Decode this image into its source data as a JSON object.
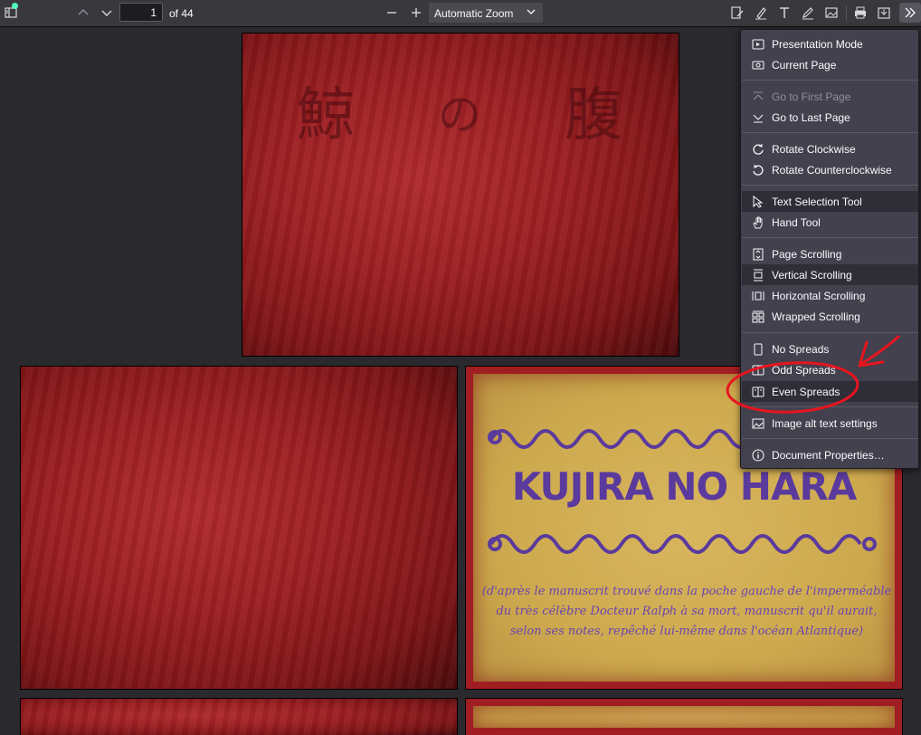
{
  "toolbar": {
    "page_number": "1",
    "page_count": "of 44",
    "zoom_value": "Automatic Zoom"
  },
  "document": {
    "cover_kanji": [
      "鯨",
      "の",
      "腹"
    ],
    "title": "KUJIRA NO HARA",
    "caption": "(d'après le manuscrit trouvé dans la poche gauche de l'imperméable du très célèbre Docteur Ralph à sa mort, manuscrit qu'il aurait, selon ses notes, repêché lui-même dans l'océan Atlantique)"
  },
  "menu": {
    "items": [
      {
        "label": "Presentation Mode",
        "icon": "presentation-icon"
      },
      {
        "label": "Current Page",
        "icon": "current-page-icon"
      },
      {
        "label": "Go to First Page",
        "icon": "first-page-icon",
        "disabled": true
      },
      {
        "label": "Go to Last Page",
        "icon": "last-page-icon"
      },
      {
        "label": "Rotate Clockwise",
        "icon": "rotate-cw-icon"
      },
      {
        "label": "Rotate Counterclockwise",
        "icon": "rotate-ccw-icon"
      },
      {
        "label": "Text Selection Tool",
        "icon": "cursor-icon",
        "selected": true
      },
      {
        "label": "Hand Tool",
        "icon": "hand-icon"
      },
      {
        "label": "Page Scrolling",
        "icon": "page-scroll-icon"
      },
      {
        "label": "Vertical Scrolling",
        "icon": "vertical-scroll-icon",
        "selected": true
      },
      {
        "label": "Horizontal Scrolling",
        "icon": "horizontal-scroll-icon"
      },
      {
        "label": "Wrapped Scrolling",
        "icon": "wrapped-scroll-icon"
      },
      {
        "label": "No Spreads",
        "icon": "no-spreads-icon"
      },
      {
        "label": "Odd Spreads",
        "icon": "odd-spreads-icon"
      },
      {
        "label": "Even Spreads",
        "icon": "even-spreads-icon",
        "selected": true
      },
      {
        "label": "Image alt text settings",
        "icon": "image-icon"
      },
      {
        "label": "Document Properties…",
        "icon": "info-icon"
      }
    ]
  },
  "colors": {
    "toolbar_bg": "#38383d",
    "menu_bg": "#42414d",
    "viewer_bg": "#2a2a2e",
    "annotation": "#e8141e"
  }
}
